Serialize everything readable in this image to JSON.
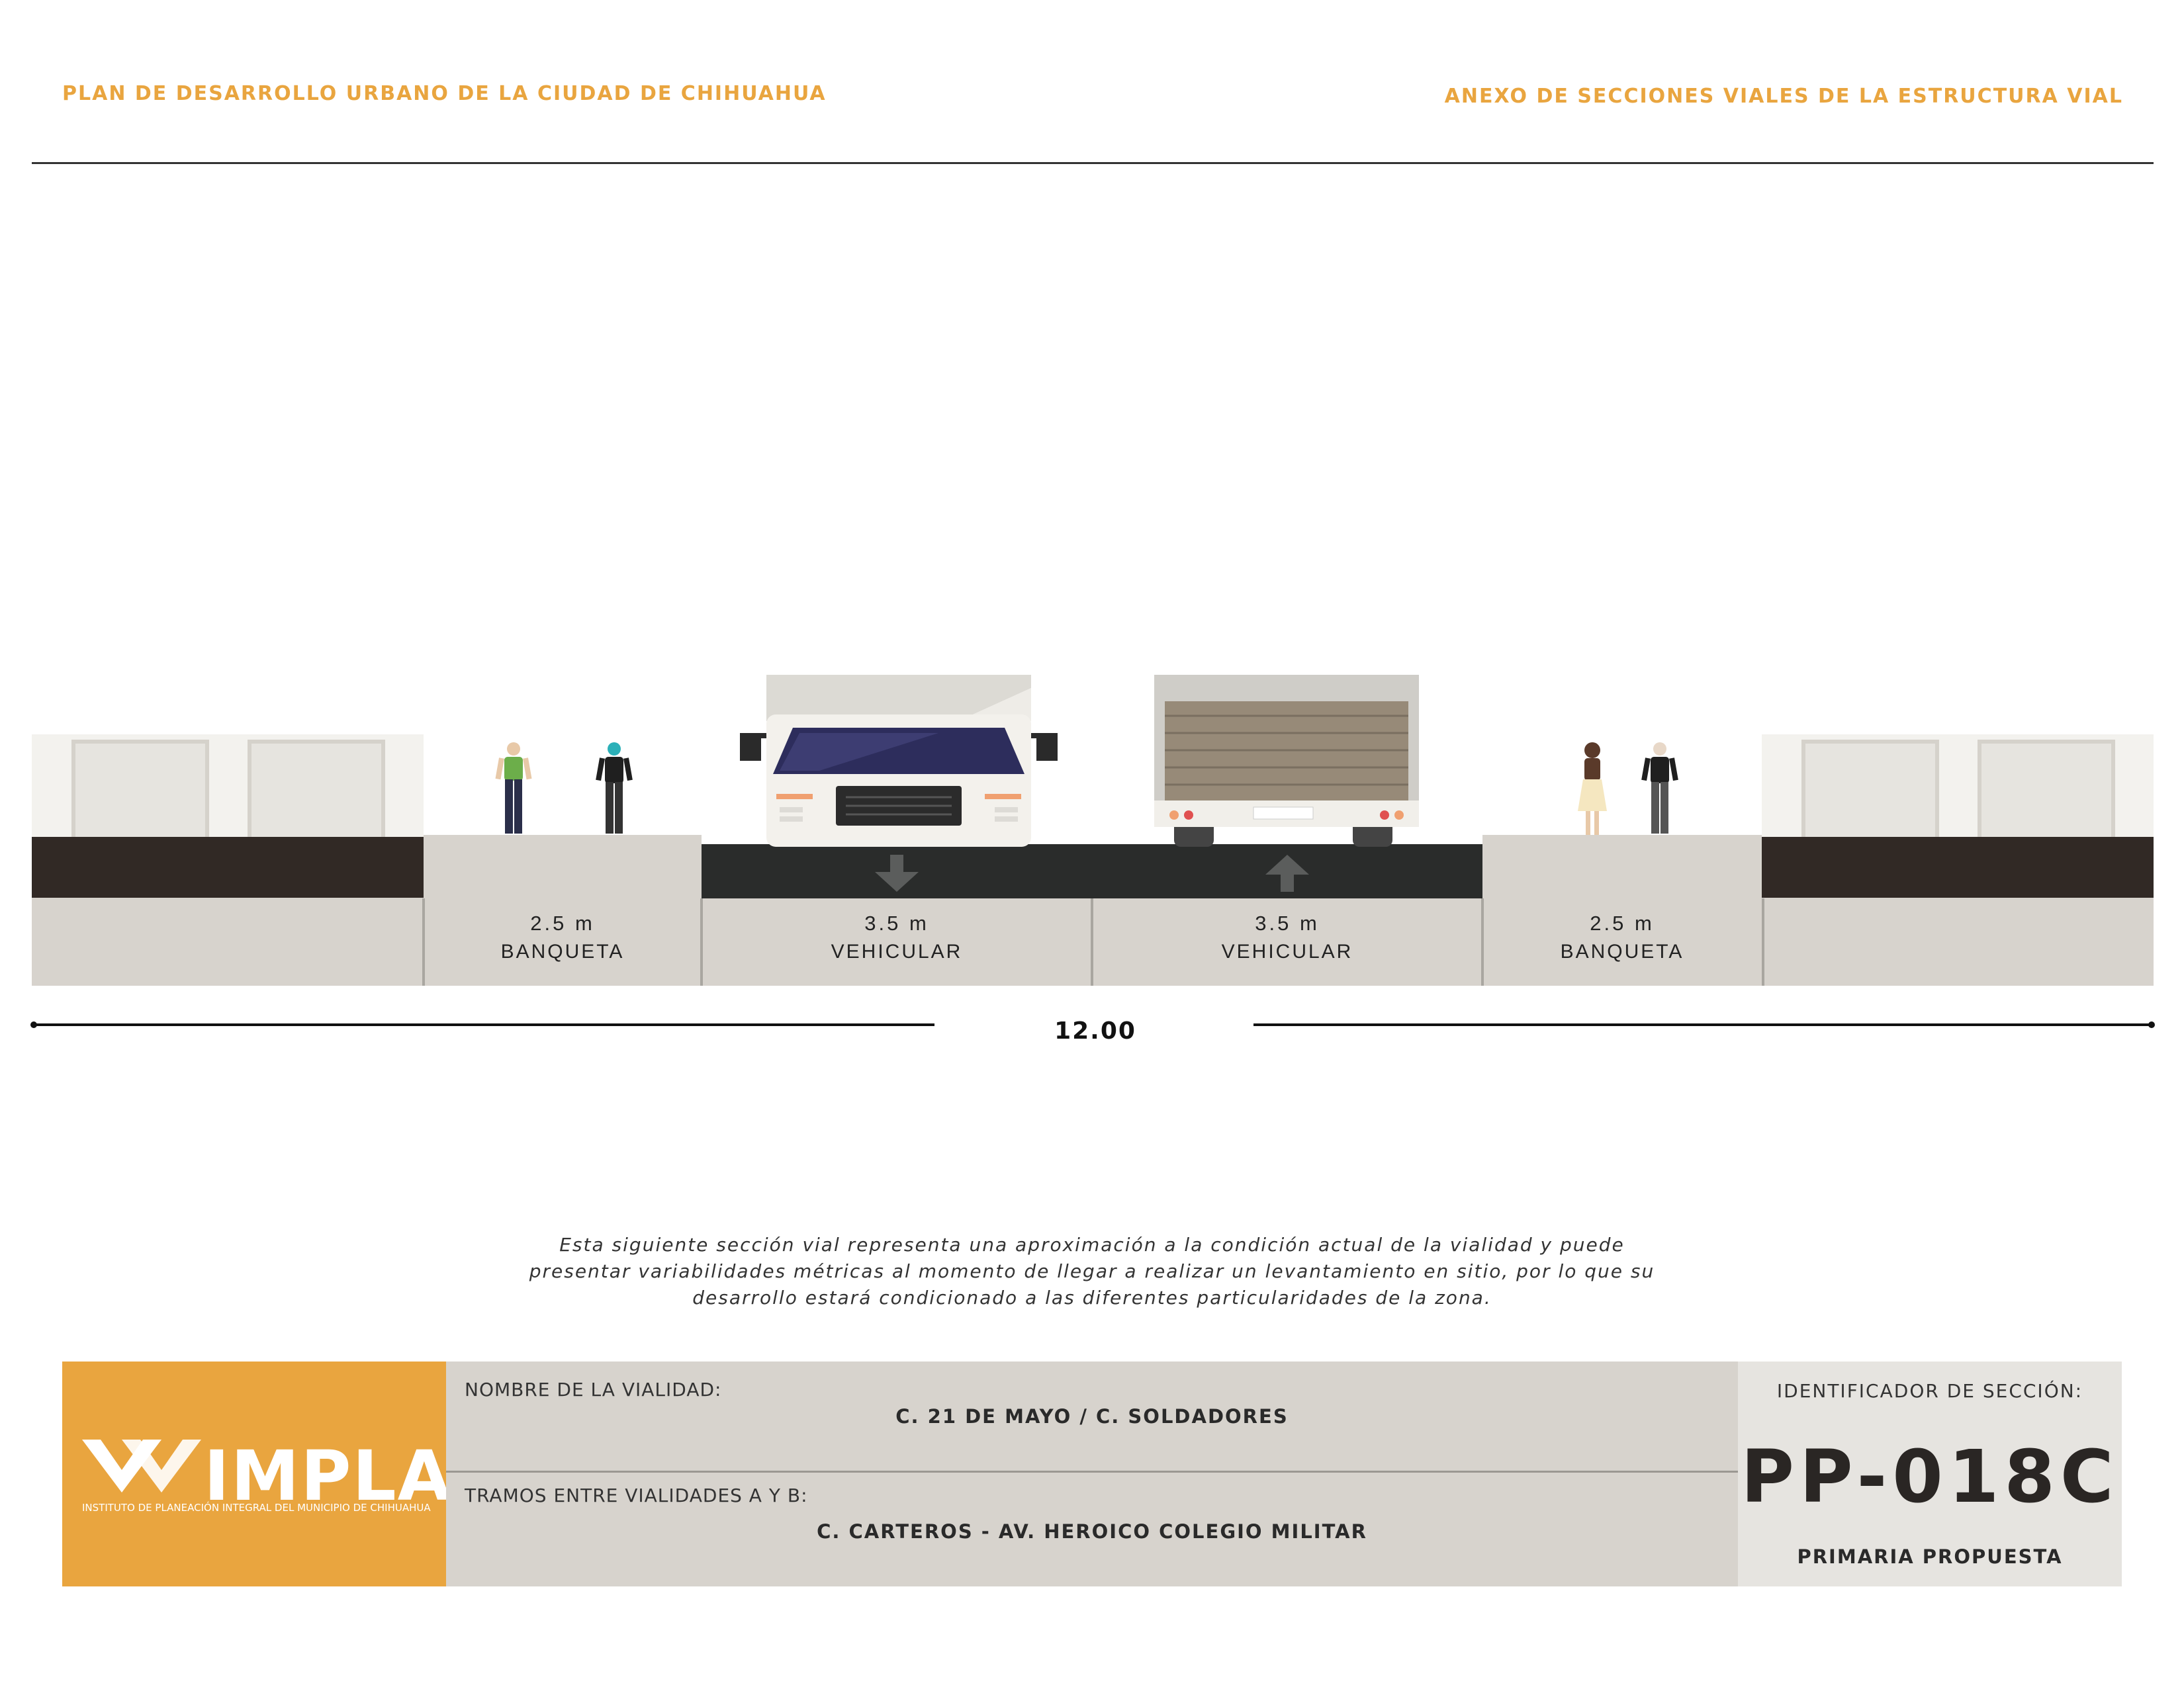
{
  "header": {
    "left_title": "PLAN DE DESARROLLO URBANO DE LA CIUDAD DE CHIHUAHUA",
    "right_title": "ANEXO DE SECCIONES VIALES DE LA ESTRUCTURA VIAL"
  },
  "section": {
    "zones": [
      {
        "width": "2.5 m",
        "name": "BANQUETA"
      },
      {
        "width": "3.5 m",
        "name": "VEHICULAR"
      },
      {
        "width": "3.5 m",
        "name": "VEHICULAR"
      },
      {
        "width": "2.5 m",
        "name": "BANQUETA"
      }
    ],
    "total_width": "12.00"
  },
  "note": "Esta siguiente sección vial representa una aproximación a la condición actual de la vialidad y puede presentar variabilidades métricas al momento de llegar a realizar un levantamiento en sitio, por lo que su desarrollo estará condicionado a las diferentes particularidades de la zona.",
  "title_block": {
    "logo_word": "IMPLAN",
    "logo_subtitle": "INSTITUTO DE PLANEACIÓN INTEGRAL DEL MUNICIPIO DE CHIHUAHUA",
    "road_name_label": "NOMBRE DE LA VIALIDAD:",
    "road_name": "C. 21 DE MAYO / C. SOLDADORES",
    "segments_label": "TRAMOS ENTRE VIALIDADES A Y B:",
    "segments": "C. CARTEROS - AV. HEROICO COLEGIO MILITAR",
    "section_id_label": "IDENTIFICADOR DE SECCIÓN:",
    "section_id": "PP-018C",
    "classification": "PRIMARIA PROPUESTA"
  },
  "colors": {
    "accent": "#e9a53f",
    "road": "#2a2c2b",
    "sidewalk": "#d7d3cd",
    "building_band": "#312925"
  }
}
